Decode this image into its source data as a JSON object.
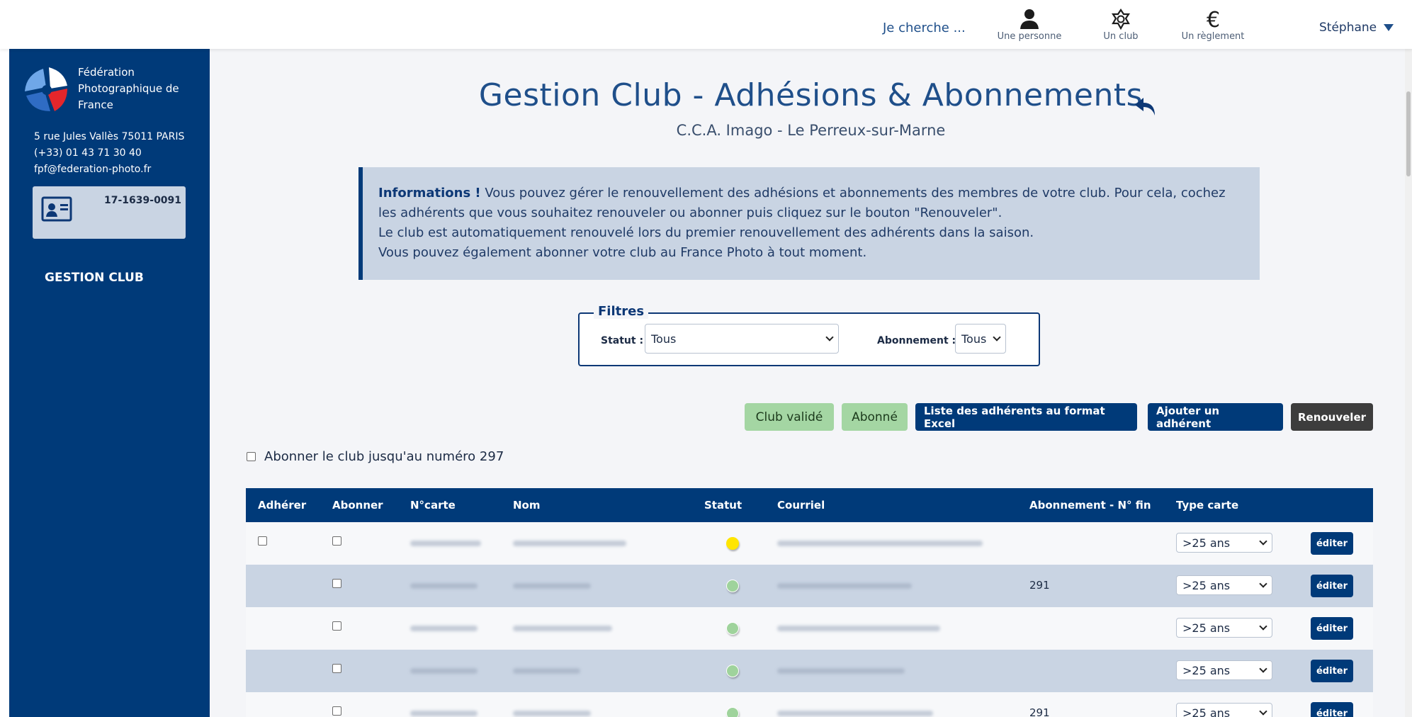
{
  "topbar": {
    "search_label": "Je cherche ...",
    "nav": [
      {
        "label": "Une personne",
        "icon": "person-icon"
      },
      {
        "label": "Un club",
        "icon": "club-icon"
      },
      {
        "label": "Un règlement",
        "icon": "euro-icon"
      }
    ],
    "user_name": "Stéphane"
  },
  "sidebar": {
    "federation_name": "Fédération Photographique de France",
    "address_line": "5 rue Jules Vallès 75011 PARIS",
    "phone": "(+33) 01 43 71 30 40",
    "email": "fpf@federation-photo.fr",
    "card_number": "17-1639-0091",
    "menu_label": "GESTION CLUB"
  },
  "page": {
    "title": "Gestion Club - Adhésions & Abonnements",
    "subtitle": "C.C.A. Imago - Le Perreux-sur-Marne"
  },
  "info": {
    "bold": "Informations !",
    "line1": " Vous pouvez gérer le renouvellement des adhésions et abonnements des membres de votre club. Pour cela, cochez les adhérents que vous souhaitez renouveler ou abonner puis cliquez sur le bouton \"Renouveler\".",
    "line2": "Le club est automatiquement renouvelé lors du premier renouvellement des adhérents dans la saison.",
    "line3": "Vous pouvez également abonner votre club au France Photo à tout moment."
  },
  "filters": {
    "legend": "Filtres",
    "statut_label": "Statut :",
    "statut_value": "Tous",
    "abonnement_label": "Abonnement :",
    "abonnement_value": "Tous"
  },
  "actions": {
    "club_valide": "Club validé",
    "abonne": "Abonné",
    "excel": "Liste des adhérents au format Excel",
    "ajouter": "Ajouter un adhérent",
    "renouveler": "Renouveler"
  },
  "abonner_club_label": "Abonner le club jusqu'au numéro 297",
  "table": {
    "headers": [
      "Adhérer",
      "Abonner",
      "N°carte",
      "Nom",
      "Statut",
      "Courriel",
      "Abonnement - N° fin",
      "Type carte"
    ],
    "rows": [
      {
        "has_adherer": true,
        "status": "yellow",
        "fin": "",
        "type": ">25 ans",
        "edit": "éditer"
      },
      {
        "has_adherer": false,
        "status": "green",
        "fin": "291",
        "type": ">25 ans",
        "edit": "éditer"
      },
      {
        "has_adherer": false,
        "status": "green",
        "fin": "",
        "type": ">25 ans",
        "edit": "éditer"
      },
      {
        "has_adherer": false,
        "status": "green",
        "fin": "",
        "type": ">25 ans",
        "edit": "éditer"
      },
      {
        "has_adherer": false,
        "status": "green",
        "fin": "291",
        "type": ">25 ans",
        "edit": "éditer"
      }
    ]
  },
  "colors": {
    "primary": "#003a79",
    "info_bg": "#c9d4e3",
    "status_yellow": "#ffe500",
    "status_green": "#9fd39c",
    "button_green": "#a4d6a3",
    "button_dark": "#3d3d3d"
  }
}
